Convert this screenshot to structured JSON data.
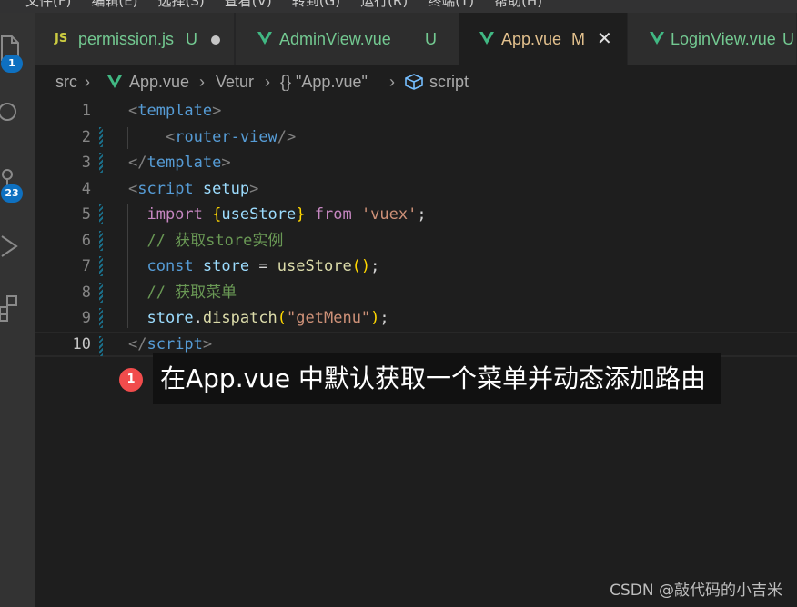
{
  "menubar": {
    "items": [
      "文件(F)",
      "编辑(E)",
      "选择(S)",
      "查看(V)",
      "转到(G)",
      "运行(R)",
      "终端(T)",
      "帮助(H)"
    ]
  },
  "activity_bar": {
    "explorer_badge": "1",
    "source_control_badge": "23"
  },
  "tabs": [
    {
      "label": "permission.js",
      "status": "U",
      "icon": "js-icon",
      "color": "#73c991"
    },
    {
      "label": "AdminView.vue",
      "status": "U",
      "icon": "vue-icon",
      "color": "#73c991"
    },
    {
      "label": "App.vue",
      "status": "M",
      "icon": "vue-icon",
      "color": "#e2c08d",
      "active": true
    },
    {
      "label": "LoginView.vue",
      "status": "U",
      "icon": "vue-icon",
      "color": "#73c991"
    }
  ],
  "breadcrumb": {
    "items": [
      "src",
      "App.vue",
      "Vetur",
      "{} \"App.vue\"",
      "script"
    ]
  },
  "editor": {
    "line_numbers": [
      "1",
      "2",
      "3",
      "4",
      "5",
      "6",
      "7",
      "8",
      "9",
      "10"
    ],
    "lines": [
      {
        "n": "1",
        "tokens": [
          {
            "t": "<",
            "c": "t-tag"
          },
          {
            "t": "template",
            "c": "t-name"
          },
          {
            "t": ">",
            "c": "t-tag"
          }
        ]
      },
      {
        "n": "2",
        "tokens": [
          {
            "t": "    ",
            "c": "t-plain"
          },
          {
            "t": "<",
            "c": "t-tag"
          },
          {
            "t": "router-view",
            "c": "t-name"
          },
          {
            "t": "/>",
            "c": "t-tag"
          }
        ]
      },
      {
        "n": "3",
        "tokens": [
          {
            "t": "</",
            "c": "t-tag"
          },
          {
            "t": "template",
            "c": "t-name"
          },
          {
            "t": ">",
            "c": "t-tag"
          }
        ]
      },
      {
        "n": "4",
        "tokens": [
          {
            "t": "<",
            "c": "t-tag"
          },
          {
            "t": "script",
            "c": "t-name"
          },
          {
            "t": " ",
            "c": "t-plain"
          },
          {
            "t": "setup",
            "c": "t-attr"
          },
          {
            "t": ">",
            "c": "t-tag"
          }
        ]
      },
      {
        "n": "5",
        "tokens": [
          {
            "t": "  import ",
            "c": "t-kw"
          },
          {
            "t": "{",
            "c": "t-brace"
          },
          {
            "t": "useStore",
            "c": "t-var"
          },
          {
            "t": "}",
            "c": "t-brace"
          },
          {
            "t": " from ",
            "c": "t-kw"
          },
          {
            "t": "'vuex'",
            "c": "t-str"
          },
          {
            "t": ";",
            "c": "t-plain"
          }
        ]
      },
      {
        "n": "6",
        "tokens": [
          {
            "t": "  // 获取store实例",
            "c": "t-cmt"
          }
        ]
      },
      {
        "n": "7",
        "tokens": [
          {
            "t": "  const ",
            "c": "t-name"
          },
          {
            "t": "store",
            "c": "t-var"
          },
          {
            "t": " = ",
            "c": "t-plain"
          },
          {
            "t": "useStore",
            "c": "t-fn"
          },
          {
            "t": "()",
            "c": "t-brace"
          },
          {
            "t": ";",
            "c": "t-plain"
          }
        ]
      },
      {
        "n": "8",
        "tokens": [
          {
            "t": "  // 获取菜单",
            "c": "t-cmt"
          }
        ]
      },
      {
        "n": "9",
        "tokens": [
          {
            "t": "  store",
            "c": "t-var"
          },
          {
            "t": ".",
            "c": "t-plain"
          },
          {
            "t": "dispatch",
            "c": "t-fn"
          },
          {
            "t": "(",
            "c": "t-brace"
          },
          {
            "t": "\"getMenu\"",
            "c": "t-str"
          },
          {
            "t": ")",
            "c": "t-brace"
          },
          {
            "t": ";",
            "c": "t-plain"
          }
        ]
      },
      {
        "n": "10",
        "tokens": [
          {
            "t": "</",
            "c": "t-tag"
          },
          {
            "t": "script",
            "c": "t-name"
          },
          {
            "t": ">",
            "c": "t-tag"
          }
        ]
      }
    ]
  },
  "error_badge": "1",
  "caption": "在App.vue 中默认获取一个菜单并动态添加路由",
  "watermark": "CSDN @敲代码的小吉米",
  "colors": {
    "untracked": "#73c991",
    "modified": "#e2c08d",
    "vue_green": "#41b883",
    "badge_blue": "#0e70c0",
    "error_red": "#f14c4c"
  }
}
